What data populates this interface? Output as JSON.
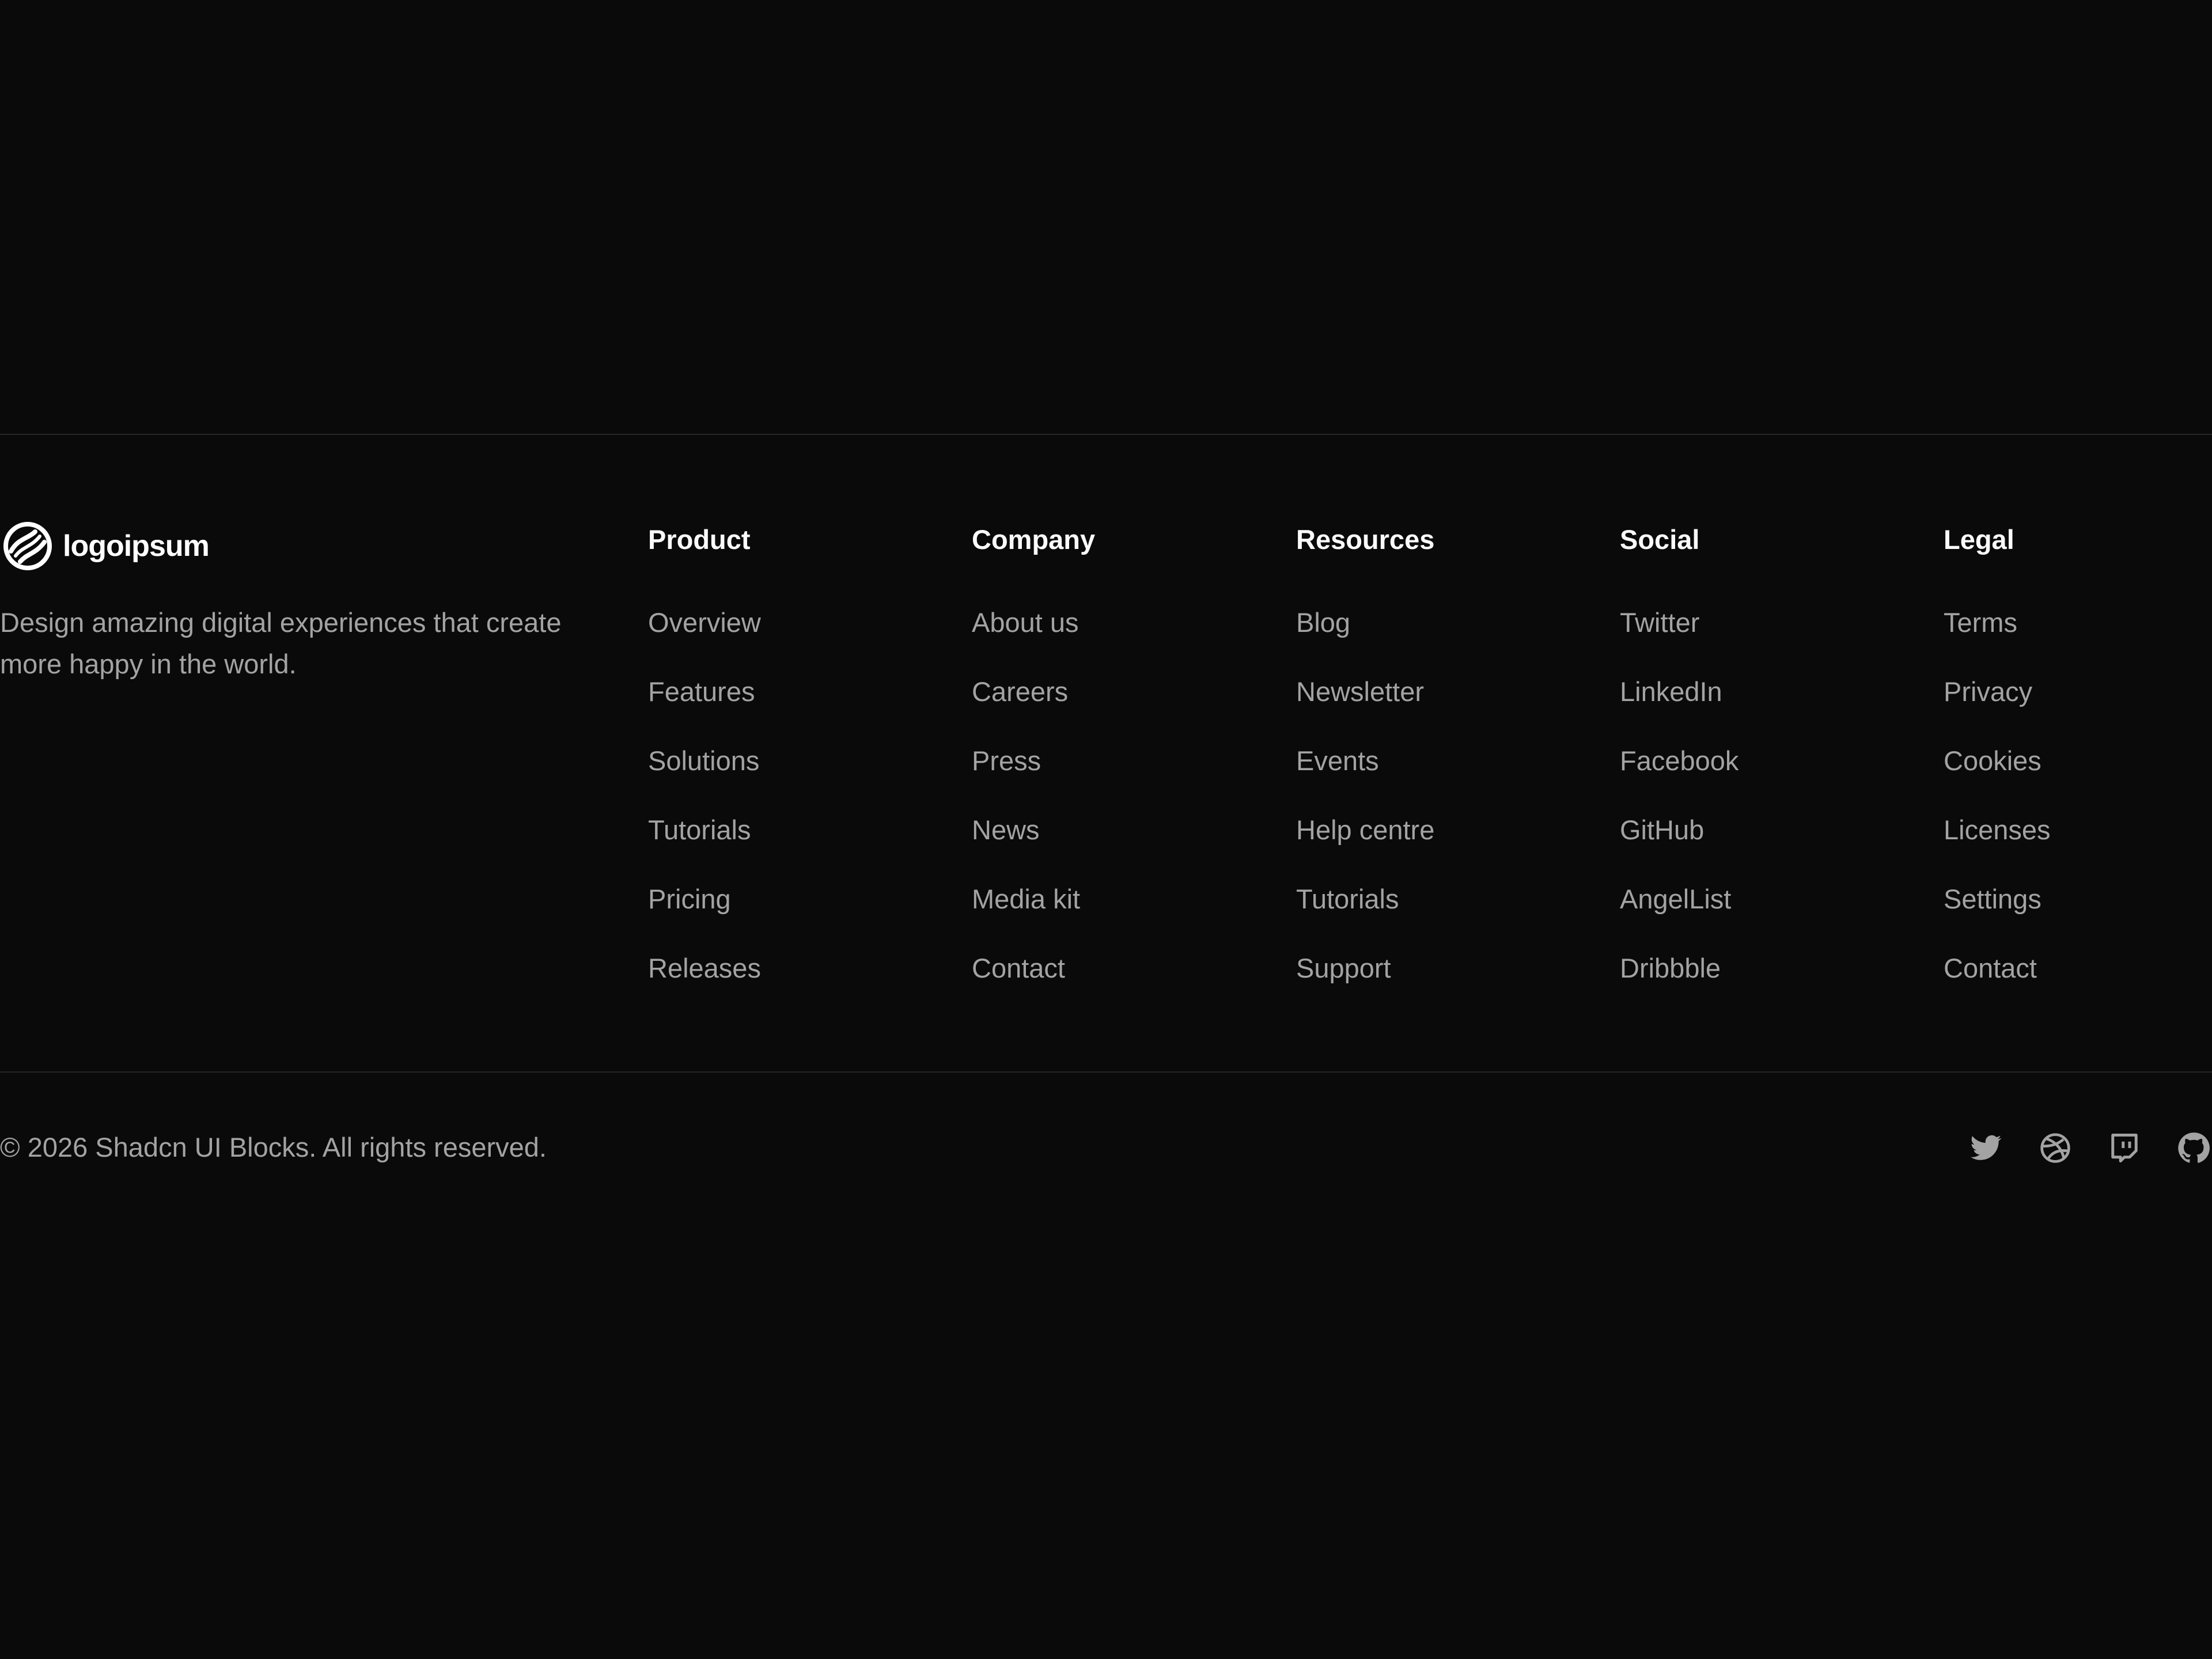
{
  "brand": {
    "name": "logoipsum",
    "tagline": "Design amazing digital experiences that create more happy in the world."
  },
  "columns": [
    {
      "heading": "Product",
      "links": [
        "Overview",
        "Features",
        "Solutions",
        "Tutorials",
        "Pricing",
        "Releases"
      ]
    },
    {
      "heading": "Company",
      "links": [
        "About us",
        "Careers",
        "Press",
        "News",
        "Media kit",
        "Contact"
      ]
    },
    {
      "heading": "Resources",
      "links": [
        "Blog",
        "Newsletter",
        "Events",
        "Help centre",
        "Tutorials",
        "Support"
      ]
    },
    {
      "heading": "Social",
      "links": [
        "Twitter",
        "LinkedIn",
        "Facebook",
        "GitHub",
        "AngelList",
        "Dribbble"
      ]
    },
    {
      "heading": "Legal",
      "links": [
        "Terms",
        "Privacy",
        "Cookies",
        "Licenses",
        "Settings",
        "Contact"
      ]
    }
  ],
  "copyright": "© 2026 Shadcn UI Blocks. All rights reserved.",
  "social_icons": [
    "twitter-icon",
    "dribbble-icon",
    "twitch-icon",
    "github-icon"
  ],
  "colors": {
    "background": "#0a0a0a",
    "heading": "#fafafa",
    "muted": "#a3a3a3",
    "divider": "#262626"
  }
}
